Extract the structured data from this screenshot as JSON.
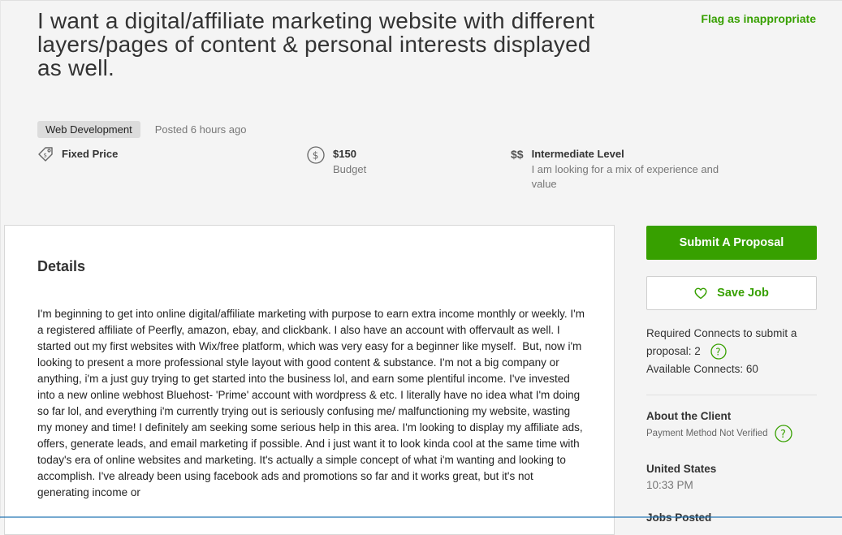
{
  "job": {
    "title": "I want a digital/affiliate marketing website with different layers/pages of content & personal interests displayed as well.",
    "flag_label": "Flag as inappropriate",
    "category": "Web Development",
    "posted": "Posted 6 hours ago"
  },
  "features": {
    "price_type": "Fixed Price",
    "budget_value": "$150",
    "budget_label": "Budget",
    "level_symbol": "$$",
    "level_title": "Intermediate Level",
    "level_desc": "I am looking for a mix of experience and value"
  },
  "details": {
    "heading": "Details",
    "body": "I'm beginning to get into online digital/affiliate marketing with purpose to earn extra income monthly or weekly. I'm a registered affiliate of Peerfly, amazon, ebay, and clickbank. I also have an account with offervault as well. I started out my first websites with Wix/free platform, which was very easy for a beginner like myself.  But, now i'm looking to present a more professional style layout with good content & substance. I'm not a big company or anything, i'm a just guy trying to get started into the business lol, and earn some plentiful income. I've invested into a new online webhost Bluehost- 'Prime' account with wordpress & etc. I literally have no idea what I'm doing so far lol, and everything i'm currently trying out is seriously confusing me/ malfunctioning my website, wasting my money and time! I definitely am seeking some serious help in this area. I'm looking to display my affiliate ads, offers, generate leads, and email marketing if possible. And i just want it to look kinda cool at the same time with today's era of online websites and marketing. It's actually a simple concept of what i'm wanting and looking to accomplish. I've already been using facebook ads and promotions so far and it works great, but it's not generating income or"
  },
  "sidebar": {
    "submit_label": "Submit A Proposal",
    "save_label": "Save Job",
    "connects_required": "Required Connects to submit a proposal: 2",
    "connects_available": "Available Connects: 60",
    "client_heading": "About the Client",
    "payment_status": "Payment Method Not Verified",
    "country": "United States",
    "local_time": "10:33 PM",
    "jobs_posted": "Jobs Posted"
  },
  "colors": {
    "accent": "#37a000",
    "background": "#f4f4f4",
    "card": "#ffffff"
  },
  "icons": {
    "price": "tag-icon",
    "budget": "dollar-circle-icon",
    "save": "heart-icon",
    "help": "question-circle-icon"
  }
}
